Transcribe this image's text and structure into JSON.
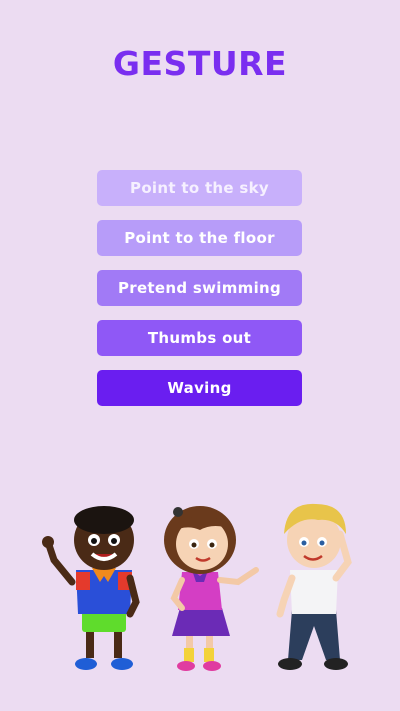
{
  "title": "GESTURE",
  "options": [
    {
      "label": "Point to the sky"
    },
    {
      "label": "Point to the floor"
    },
    {
      "label": "Pretend swimming"
    },
    {
      "label": "Thumbs out"
    },
    {
      "label": "Waving"
    }
  ],
  "colors": {
    "background": "#ecdcf2",
    "title": "#7a2ef0",
    "option_1": "#c8b0fb",
    "option_2": "#b79cf9",
    "option_3": "#a17af6",
    "option_4": "#8f58f6",
    "option_5": "#6a1ef0"
  },
  "illustration": {
    "figures": [
      "boy-waving-illustration",
      "girl-pointing-illustration",
      "boy-saluting-illustration"
    ]
  }
}
